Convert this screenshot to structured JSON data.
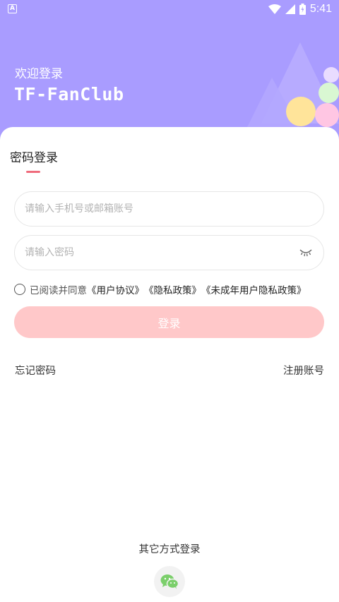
{
  "status_bar": {
    "app_icon_letter": "A",
    "time": "5:41",
    "icons": [
      "wifi-icon",
      "signal-icon",
      "battery-icon"
    ]
  },
  "header": {
    "welcome": "欢迎登录",
    "app_name": "TF-FanClub"
  },
  "login": {
    "title": "密码登录",
    "account_placeholder": "请输入手机号或邮箱账号",
    "account_value": "",
    "password_placeholder": "请输入密码",
    "password_value": "",
    "agree_prefix": "已阅读并同意",
    "user_agreement": "《用户协议》",
    "privacy_policy": "《隐私政策》",
    "minor_privacy_policy": "《未成年用户隐私政策》",
    "agreed": false,
    "submit_label": "登录",
    "forgot_password": "忘记密码",
    "register": "注册账号"
  },
  "other_login": {
    "label": "其它方式登录",
    "methods": [
      "wechat-icon"
    ]
  },
  "colors": {
    "header_bg": "#a99cff",
    "accent_underline": "#ef6b7b",
    "login_button_bg": "#ffc8c9",
    "wechat_green": "#7bcf6b"
  }
}
